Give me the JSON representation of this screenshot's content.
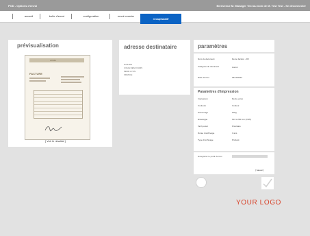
{
  "titlebar": {
    "app_title": "POD - Options d'envoi",
    "welcome": "Bienvenue M. Manager Test au nom de M. Test Test - Se déconnecter"
  },
  "tabs": [
    {
      "label": "accueil"
    },
    {
      "label": "boîte d'envoi"
    },
    {
      "label": "configuration"
    },
    {
      "label": "envoi courrier"
    },
    {
      "label": "récapitulatif"
    }
  ],
  "preview": {
    "title": "prévisualisation",
    "doc_brand": "ACME",
    "doc_heading": "FACTURE",
    "view_link": "[ Voir le résultat ]"
  },
  "address": {
    "title": "adresse destinataire",
    "lines": [
      "M DURE",
      "3 RUE DES FOURS",
      "69000 LYON",
      "FRANCE"
    ]
  },
  "params": {
    "title": "paramètres",
    "doc": [
      {
        "key": "Nom du document",
        "value": "Demo facture - FR"
      },
      {
        "key": "Catégorie de document",
        "value": "Aucun"
      },
      {
        "key": "Date d'envoi",
        "value": "04/10/2012"
      }
    ],
    "print_title": "Paramètres d'impression",
    "print": [
      {
        "key": "Impression",
        "value": "Recto-verso"
      },
      {
        "key": "Couleurs",
        "value": "Couleur"
      },
      {
        "key": "Grammage",
        "value": "100g"
      },
      {
        "key": "Enveloppe",
        "value": "114 x 229 mm (C5/6)"
      },
      {
        "key": "Tarif postal",
        "value": "Prioritaire"
      },
      {
        "key": "Durée d'archivage",
        "value": "3 ans"
      },
      {
        "key": "Type d'archivage",
        "value": "Probant"
      }
    ],
    "save_label": "Enregistrer le profil d'envoi",
    "save_button": "[ Sauver ]"
  },
  "icons": {
    "back": "circle-back-icon",
    "confirm": "check-icon"
  },
  "logo": "YOUR LOGO",
  "colors": {
    "active_tab": "#0b63c4",
    "logo": "#d8432a"
  }
}
